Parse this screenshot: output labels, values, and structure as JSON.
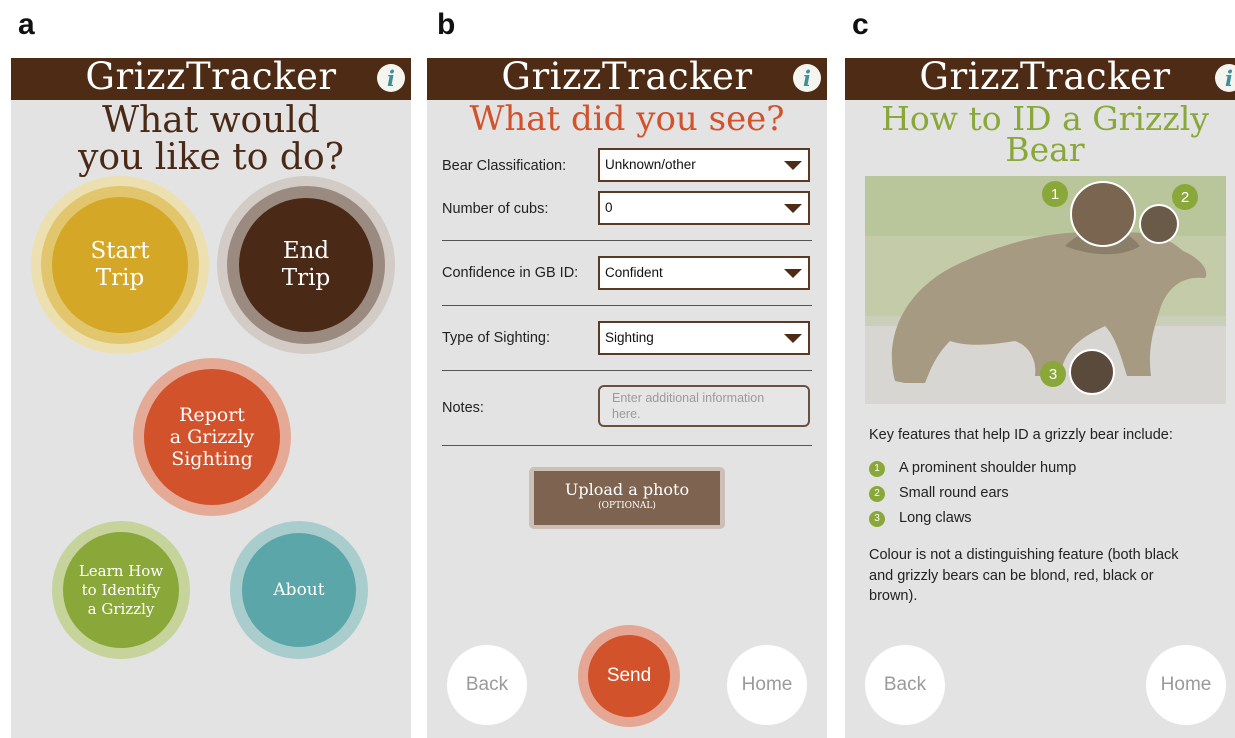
{
  "panels": {
    "a": {
      "letter": "a",
      "app_title": "GrizzTracker",
      "heading_line1": "What would",
      "heading_line2": "you like to do?",
      "buttons": {
        "start_trip_1": "Start",
        "start_trip_2": "Trip",
        "end_trip_1": "End",
        "end_trip_2": "Trip",
        "report_1": "Report",
        "report_2": "a Grizzly",
        "report_3": "Sighting",
        "learn_1": "Learn How",
        "learn_2": "to Identify",
        "learn_3": "a Grizzly",
        "about": "About"
      }
    },
    "b": {
      "letter": "b",
      "app_title": "GrizzTracker",
      "heading": "What did you see?",
      "fields": {
        "bear_classification_label": "Bear Classification:",
        "bear_classification_value": "Unknown/other",
        "cubs_label": "Number of cubs:",
        "cubs_value": "0",
        "confidence_label": "Confidence in GB ID:",
        "confidence_value": "Confident",
        "type_label": "Type of Sighting:",
        "type_value": "Sighting",
        "notes_label": "Notes:",
        "notes_placeholder": "Enter additional information here."
      },
      "upload_label": "Upload a photo",
      "upload_sub": "(OPTIONAL)",
      "back": "Back",
      "send": "Send",
      "home": "Home"
    },
    "c": {
      "letter": "c",
      "app_title": "GrizzTracker",
      "heading_line1": "How to ID a Grizzly",
      "heading_line2": "Bear",
      "markers": [
        "1",
        "2",
        "3"
      ],
      "intro": "Key features that help ID a grizzly bear include:",
      "features": [
        "A prominent shoulder hump",
        "Small round ears",
        "Long claws"
      ],
      "note_line1": "Colour is not a distinguishing feature (both black",
      "note_line2": "and grizzly bears can be blond, red, black or",
      "note_line3": "brown).",
      "back": "Back",
      "home": "Home"
    }
  },
  "colors": {
    "header": "#4e2b14",
    "mustard": "#d4a726",
    "dark_brown": "#4a2916",
    "orange": "#d2522b",
    "green": "#8aa83a",
    "teal": "#5aa6a9",
    "info_icon": "#3d8f9a"
  },
  "icons": [
    "info-icon",
    "dropdown-arrow-icon",
    "number-marker-icon"
  ]
}
